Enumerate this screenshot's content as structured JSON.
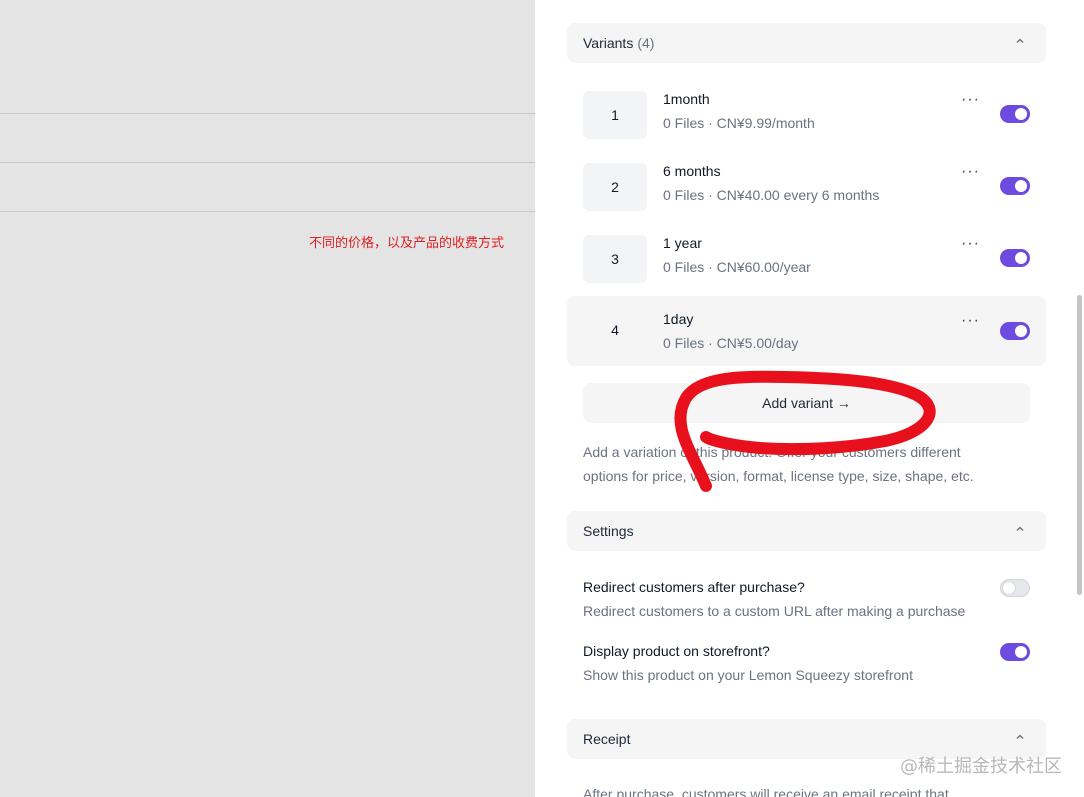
{
  "annotation": "不同的价格，以及产品的收费方式",
  "variants_section": {
    "title": "Variants",
    "count": "(4)",
    "items": [
      {
        "index": "1",
        "name": "1month",
        "details": "0 Files · CN¥9.99/month",
        "menu": "···",
        "enabled": true
      },
      {
        "index": "2",
        "name": "6 months",
        "details": "0 Files · CN¥40.00 every 6 months",
        "menu": "···",
        "enabled": true
      },
      {
        "index": "3",
        "name": "1 year",
        "details": "0 Files · CN¥60.00/year",
        "menu": "···",
        "enabled": true
      },
      {
        "index": "4",
        "name": "1day",
        "details": "0 Files · CN¥5.00/day",
        "menu": "···",
        "enabled": true
      }
    ],
    "add_button": "Add variant →",
    "help_line1": "Add a variation of this product. Offer your customers different",
    "help_line2": "options for price, version, format, license type, size, shape, etc."
  },
  "settings_section": {
    "title": "Settings",
    "redirect_title": "Redirect customers after purchase?",
    "redirect_desc": "Redirect customers to a custom URL after making a purchase",
    "redirect_enabled": false,
    "storefront_title": "Display product on storefront?",
    "storefront_desc": "Show this product on your Lemon Squeezy storefront",
    "storefront_enabled": true
  },
  "receipt_section": {
    "title": "Receipt",
    "text": "After purchase, customers will receive an email receipt that"
  },
  "watermark": "@稀土掘金技术社区",
  "colors": {
    "accent": "#6d4ae0",
    "annotation": "#e02020",
    "scribble": "#e8101c"
  }
}
